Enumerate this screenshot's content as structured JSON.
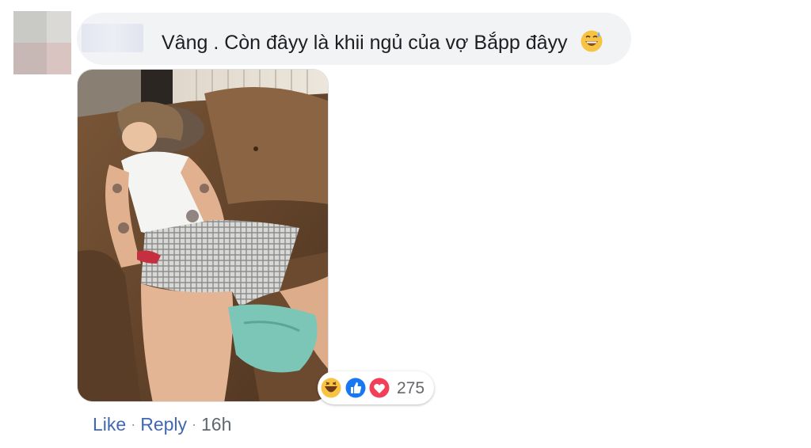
{
  "comment": {
    "text": "Vâng . Còn đâyy là khii ngủ của vợ Bắpp đâyy",
    "emoji_icon": "grinning-sweat-emoji"
  },
  "photo": {
    "subject": "person-sleeping-on-sofa"
  },
  "reactions": {
    "icons": [
      "haha-reaction-icon",
      "like-reaction-icon",
      "love-reaction-icon"
    ],
    "count": "275"
  },
  "actions": {
    "like_label": "Like",
    "separator": "·",
    "reply_label": "Reply",
    "timestamp": "16h"
  },
  "colors": {
    "link": "#4267b2",
    "bubble": "#f2f3f5",
    "like_blue": "#1877f2",
    "love_red": "#f33e58",
    "haha_yellow": "#f7c342"
  }
}
